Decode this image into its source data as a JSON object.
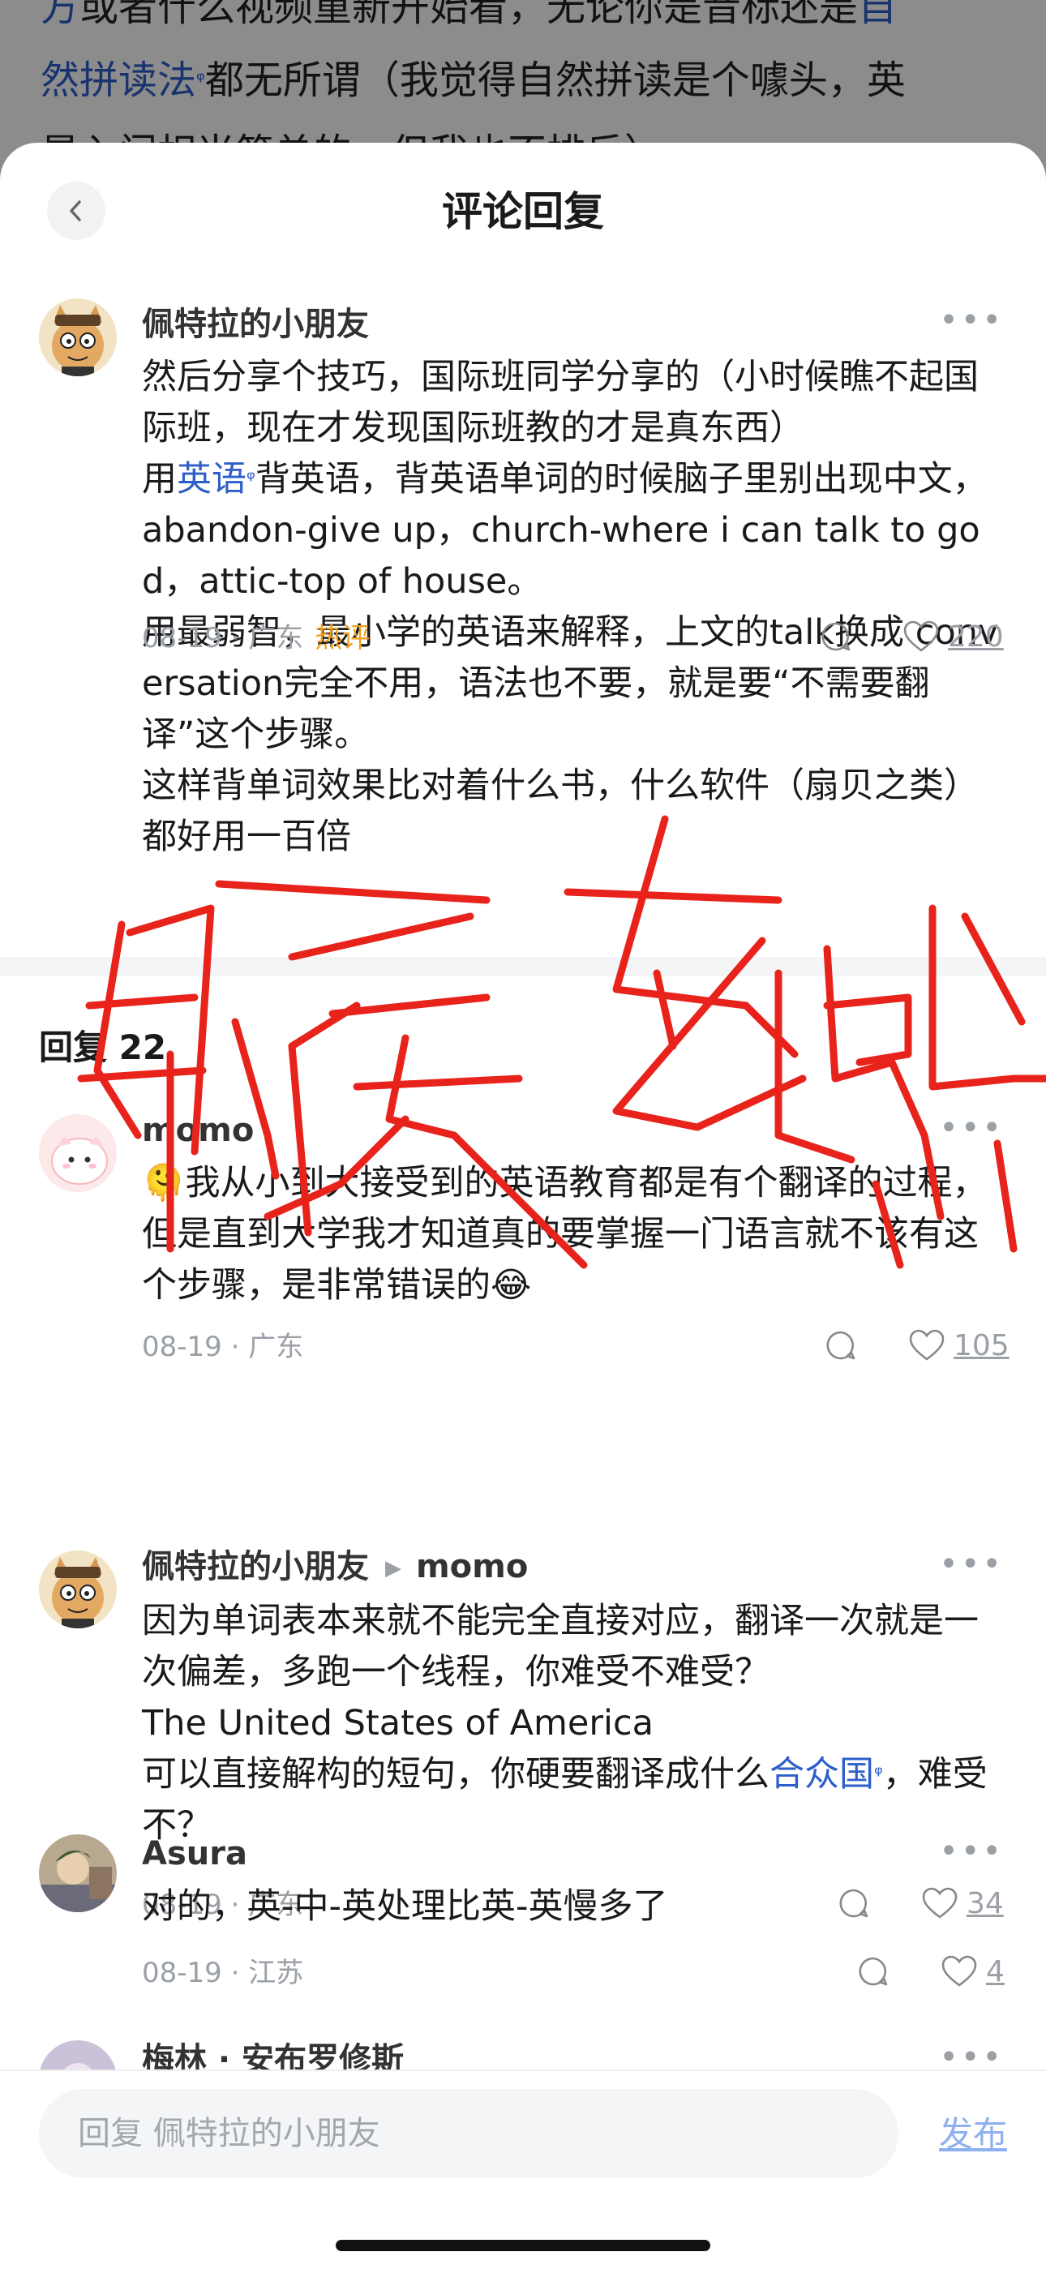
{
  "background_article": {
    "line1_prefix": "方",
    "line1": "或者什么视频重新开始看，无论你是音标还是",
    "line1_link": "自",
    "line2_link": "然拼读法",
    "line2": "都无所谓（我觉得自然拼读是个噱头，英",
    "line3": "是入门相当简单的，但我也不排斥）"
  },
  "sheet": {
    "title": "评论回复"
  },
  "main_comment": {
    "author": "佩特拉的小朋友",
    "text_part1": "然后分享个技巧，国际班同学分享的（小时候瞧不起国际班，现在才发现国际班教的才是真东西）",
    "text_part2_prefix": "用",
    "text_part2_link": "英语",
    "text_part2_rest": "背英语，背英语单词的时候脑子里别出现中文，abandon-give up，church-where i can talk to god，attic-top of house。",
    "text_part3": "用最弱智，最小学的英语来解释，上文的talk换成 conversation完全不用，语法也不要，就是要“不需要翻译”这个步骤。",
    "text_part4": "这样背单词效果比对着什么书，什么软件（扇贝之类）都好用一百倍",
    "date": "08-19",
    "location": "广东",
    "badge": "热评",
    "likes": "220"
  },
  "replies_header": {
    "label": "回复 22"
  },
  "replies": [
    {
      "author": "momo",
      "text": "🫠我从小到大接受到的英语教育都是有个翻译的过程，但是直到大学我才知道真的要掌握一门语言就不该有这个步骤，是非常错误的😂",
      "date": "08-19",
      "location": "广东",
      "likes": "105"
    },
    {
      "author": "佩特拉的小朋友",
      "reply_to": "momo",
      "text_part1": "因为单词表本来就不能完全直接对应，翻译一次就是一次偏差，多跑一个线程，你难受不难受？",
      "text_part2": "The United States of America",
      "text_part3_prefix": "可以直接解构的短句，你硬要翻译成什么",
      "text_part3_link": "合众国",
      "text_part3_rest": "，难受不？",
      "date": "08-19",
      "location": "广东",
      "likes": "34"
    },
    {
      "author": "Asura",
      "text": "对的，英-中-英处理比英-英慢多了",
      "date": "08-19",
      "location": "江苏",
      "likes": "4"
    },
    {
      "author": "梅林 · 安布罗修斯"
    }
  ],
  "bottom_bar": {
    "placeholder": "回复 佩特拉的小朋友",
    "publish": "发布"
  },
  "colors": {
    "link": "#2d5ec9",
    "hot_badge": "#f0a020",
    "scribble": "#e8231b",
    "meta_gray": "#9aa0a6"
  },
  "icons": [
    "back-chevron-icon",
    "more-dots-icon",
    "comment-bubble-icon",
    "heart-icon",
    "link-search-icon"
  ]
}
